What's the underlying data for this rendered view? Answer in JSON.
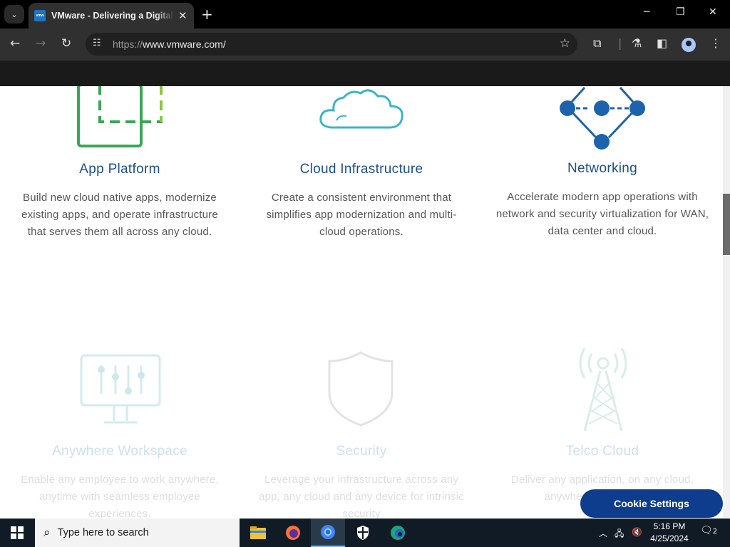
{
  "browser": {
    "tab_title": "VMware - Delivering a Digital Foundation",
    "favicon_text": "vmw",
    "url_prefix": "https://",
    "url_host": "www.vmware.com/"
  },
  "page": {
    "cards": [
      {
        "title": "App Platform",
        "text": "Build new cloud native apps, modernize existing apps, and operate infrastructure that serves them all across any cloud."
      },
      {
        "title": "Cloud Infrastructure",
        "text": "Create a consistent environment that simplifies app modernization and multi-cloud operations."
      },
      {
        "title": "Networking",
        "text": "Accelerate modern app operations with network and security virtualization for WAN, data center and cloud."
      },
      {
        "title": "Anywhere Workspace",
        "text": "Enable any employee to work anywhere, anytime with seamless employee experiences."
      },
      {
        "title": "Security",
        "text": "Leverage your infrastructure across any app, any cloud and any device for intrinsic security"
      },
      {
        "title": "Telco Cloud",
        "text": "Deliver any application, on any cloud, anywhere and the Edge"
      }
    ],
    "cookie_button": "Cookie Settings"
  },
  "taskbar": {
    "search_placeholder": "Type here to search",
    "time": "5:16 PM",
    "date": "4/25/2024",
    "notification_count": "2"
  },
  "colors": {
    "accent_blue": "#1d4f8c",
    "cookie_button": "#0d3d8c",
    "green_icon": "#3aa655",
    "teal_icon": "#3bb6c2",
    "network_blue": "#1d62ad"
  }
}
